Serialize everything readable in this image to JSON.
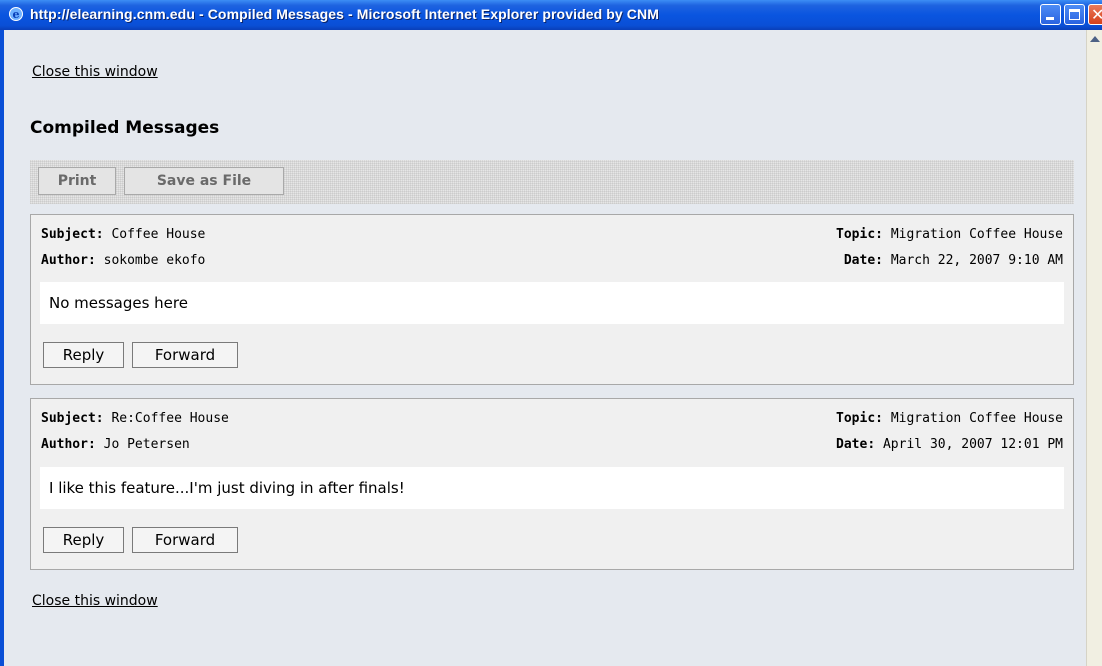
{
  "window": {
    "title": "http://elearning.cnm.edu - Compiled Messages - Microsoft Internet Explorer provided by CNM",
    "app_icon": "ie-icon",
    "controls": [
      "minimize-icon",
      "maximize-icon",
      "close-icon"
    ],
    "titlebar_color": "#0a55e0",
    "close_color": "#d6401a"
  },
  "page": {
    "close_link_top": "Close this window",
    "heading": "Compiled Messages",
    "close_link_bottom": "Close this window",
    "toolbar": {
      "print_label": "Print",
      "save_label": "Save as File"
    }
  },
  "labels": {
    "subject": "Subject:",
    "author": "Author:",
    "topic": "Topic:",
    "date": "Date:"
  },
  "messages": [
    {
      "subject": "Coffee House",
      "author": "sokombe ekofo",
      "topic": "Migration Coffee House",
      "date": "March 22, 2007 9:10 AM",
      "body": "No messages here",
      "reply_label": "Reply",
      "forward_label": "Forward"
    },
    {
      "subject": "Re:Coffee House",
      "author": "Jo Petersen",
      "topic": "Migration Coffee House",
      "date": "April 30, 2007 12:01 PM",
      "body": "I like this feature...I'm just diving in after finals!",
      "reply_label": "Reply",
      "forward_label": "Forward"
    }
  ]
}
